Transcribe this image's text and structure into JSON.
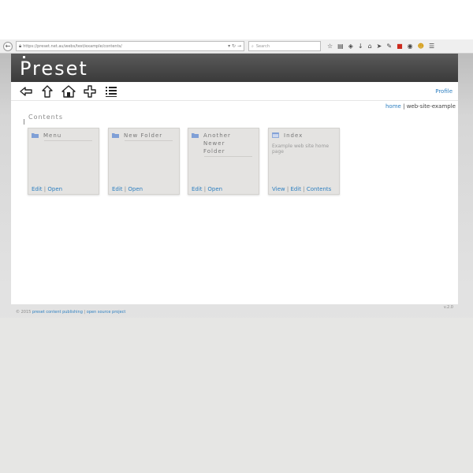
{
  "browser": {
    "url": "https://preset.net.au/webs/test/example/contents/",
    "search_placeholder": "Search"
  },
  "site": {
    "logo_text": "Preset"
  },
  "nav": {
    "profile_label": "Profile"
  },
  "breadcrumb": {
    "home": "home",
    "separator": "|",
    "current": "web-site-example"
  },
  "main": {
    "title": "Contents",
    "cards": [
      {
        "title": "Menu",
        "type": "folder",
        "actions": [
          "Edit",
          "Open"
        ]
      },
      {
        "title": "New Folder",
        "type": "folder",
        "actions": [
          "Edit",
          "Open"
        ]
      },
      {
        "title": "Another Newer Folder",
        "type": "folder",
        "actions": [
          "Edit",
          "Open"
        ]
      },
      {
        "title": "Index",
        "type": "page",
        "description": "Example web site home page",
        "actions": [
          "View",
          "Edit",
          "Contents"
        ]
      }
    ]
  },
  "footer": {
    "copyright": "© 2015",
    "link1": "preset content publishing",
    "separator": "|",
    "link2": "open source project",
    "version": "v.2.0"
  },
  "colors": {
    "accent": "#2d7fc0",
    "header_bg": "#4a4a4a",
    "card_bg": "#e4e3e1",
    "folder_icon": "#7f9fd6"
  }
}
